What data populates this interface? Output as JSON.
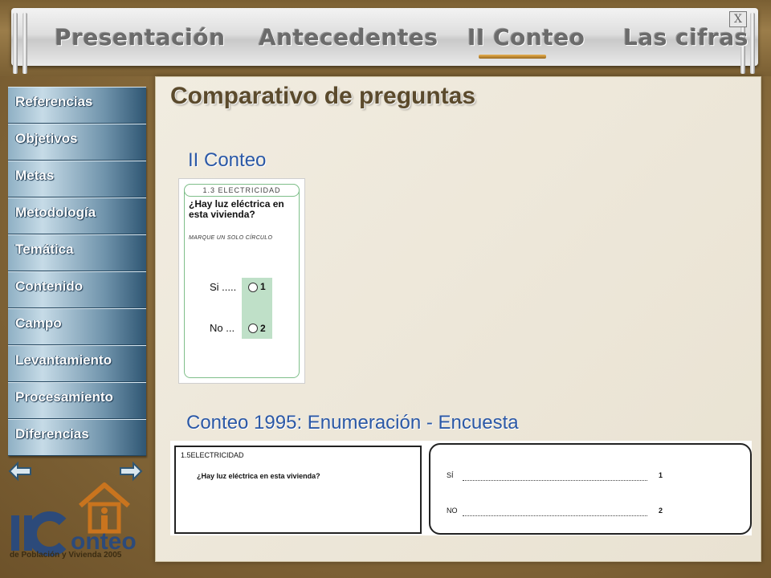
{
  "header": {
    "nav": [
      {
        "label": "Presentación"
      },
      {
        "label": "Antecedentes"
      },
      {
        "label": "II Conteo"
      },
      {
        "label": "Las cifras"
      }
    ],
    "close_label": "X"
  },
  "page": {
    "title": "Comparativo de preguntas",
    "section1_title": "II Conteo",
    "section2_title": "Conteo 1995: Enumeración - Encuesta"
  },
  "sidebar": {
    "items": [
      {
        "label": "Referencias"
      },
      {
        "label": "Objetivos"
      },
      {
        "label": "Metas"
      },
      {
        "label": "Metodología"
      },
      {
        "label": "Temática"
      },
      {
        "label": "Contenido"
      },
      {
        "label": "Campo"
      },
      {
        "label": "Levantamiento"
      },
      {
        "label": "Procesamiento"
      },
      {
        "label": "Diferencias"
      }
    ]
  },
  "logo": {
    "wordmark": "II Conteo",
    "subtitle": "de Población y Vivienda 2005"
  },
  "form2005": {
    "header": "1.3 ELECTRICIDAD",
    "question": "¿Hay luz eléctrica en esta vivienda?",
    "instruction": "MARQUE UN SOLO CÍRCULO",
    "options": [
      {
        "label": "Si .....",
        "code": "1"
      },
      {
        "label": "No ...",
        "code": "2"
      }
    ]
  },
  "form1995": {
    "header": "1.5ELECTRICIDAD",
    "question": "¿Hay luz eléctrica en esta vivienda?",
    "options": [
      {
        "label": "SÍ",
        "code": "1"
      },
      {
        "label": "NO",
        "code": "2"
      }
    ]
  }
}
